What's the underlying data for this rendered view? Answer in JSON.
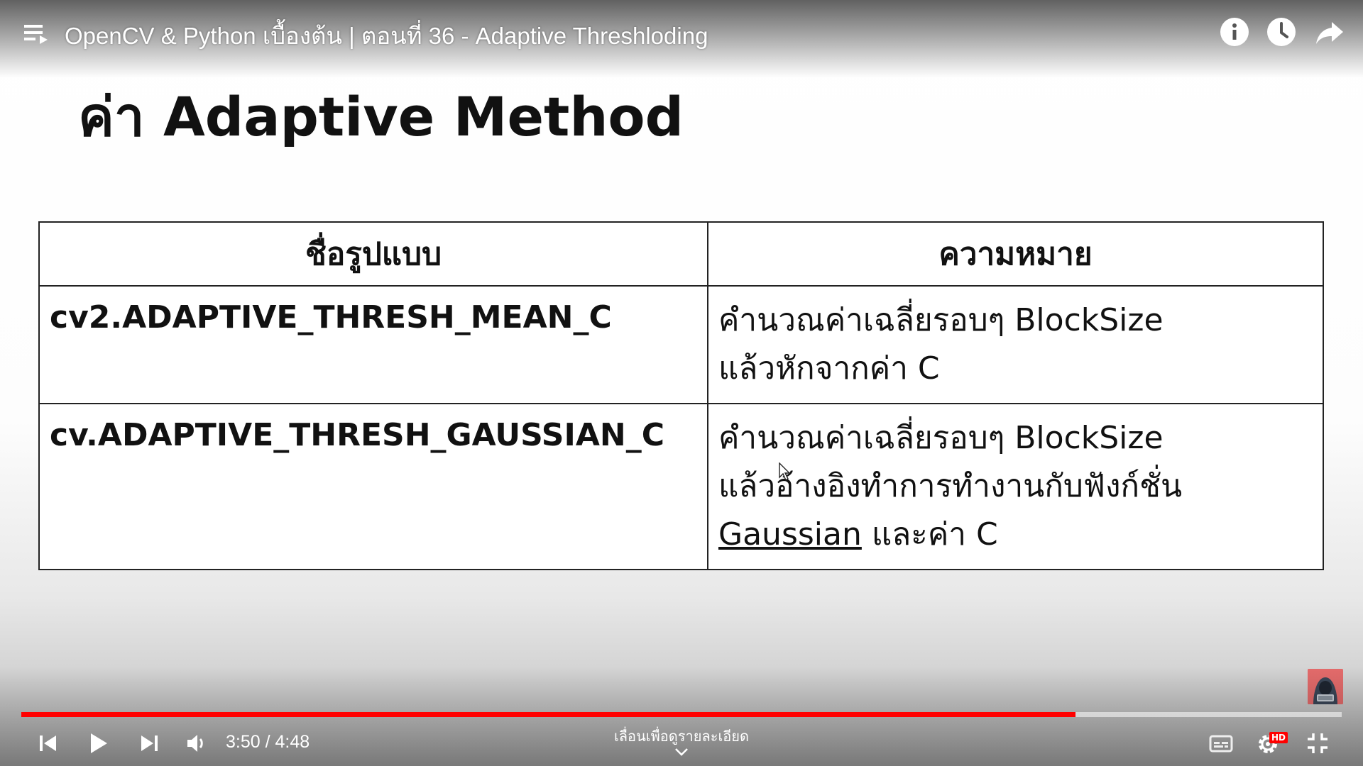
{
  "header": {
    "video_title": "OpenCV & Python เบื้องต้น | ตอนที่ 36 - Adaptive Threshloding",
    "icons": [
      "playlist-icon",
      "info-icon",
      "watch-later-icon",
      "share-icon"
    ]
  },
  "slide": {
    "heading": "ค่า Adaptive Method",
    "table": {
      "headers": [
        "ชื่อรูปแบบ",
        "ความหมาย"
      ],
      "rows": [
        {
          "name": "cv2.ADAPTIVE_THRESH_MEAN_C",
          "meaning_lines": [
            "คำนวณค่าเฉลี่ยรอบๆ BlockSize",
            "แล้วหักจากค่า C"
          ]
        },
        {
          "name": "cv.ADAPTIVE_THRESH_GAUSSIAN_C",
          "meaning_lines": [
            "คำนวณค่าเฉลี่ยรอบๆ BlockSize",
            "แล้วอ้างอิงทำการทำงานกับฟังก์ชั่น"
          ],
          "meaning_underlined": "Gaussian",
          "meaning_tail": " และค่า C"
        }
      ]
    }
  },
  "player": {
    "current_time": "3:50",
    "duration": "4:48",
    "time_text": "3:50 / 4:48",
    "progress_fraction": 0.7986,
    "scroll_hint": "เลื่อนเพื่อดูรายละเอียด",
    "hd_label": "HD",
    "colors": {
      "progress_played": "#ff0000",
      "progress_track": "#dddddd",
      "text": "#ffffff"
    },
    "control_icons": [
      "previous-icon",
      "play-icon",
      "next-icon",
      "volume-icon",
      "captions-icon",
      "settings-icon",
      "exit-fullscreen-icon"
    ]
  }
}
